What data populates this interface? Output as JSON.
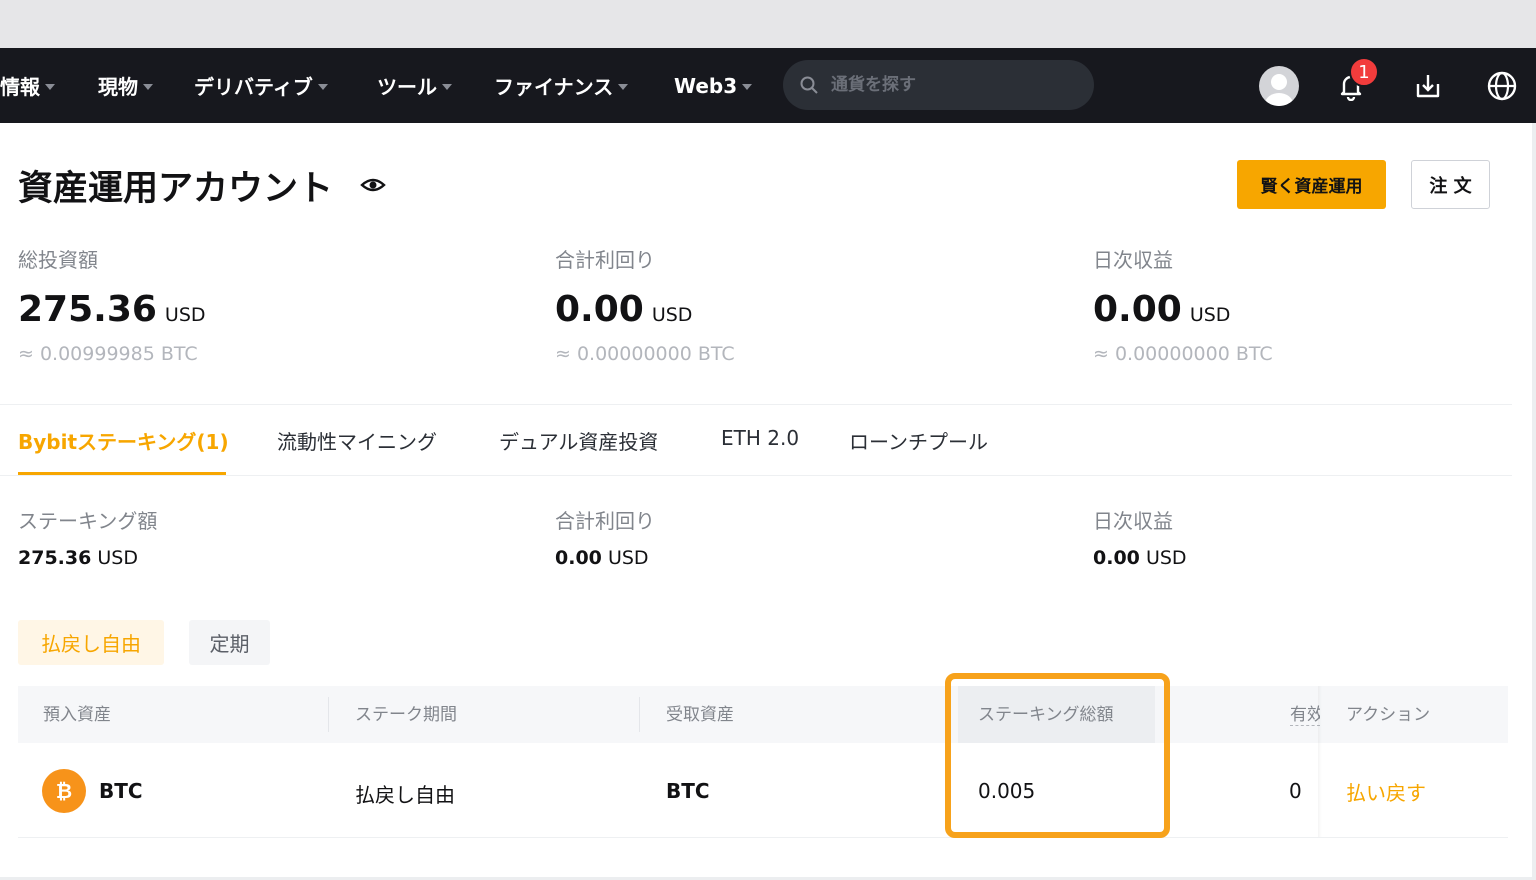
{
  "nav": {
    "items": [
      {
        "label": "情報"
      },
      {
        "label": "現物"
      },
      {
        "label": "デリバティブ"
      },
      {
        "label": "ツール"
      },
      {
        "label": "ファイナンス"
      },
      {
        "label": "Web3"
      }
    ],
    "search_placeholder": "通貨を探す",
    "notification_count": "1"
  },
  "page": {
    "title": "資産運用アカウント",
    "primary_button": "賢く資産運用",
    "secondary_button": "注 文"
  },
  "stats": [
    {
      "label": "総投資額",
      "value": "275.36",
      "unit": "USD",
      "sub": "≈ 0.00999985  BTC"
    },
    {
      "label": "合計利回り",
      "value": "0.00",
      "unit": "USD",
      "sub": "≈ 0.00000000  BTC"
    },
    {
      "label": "日次収益",
      "value": "0.00",
      "unit": "USD",
      "sub": "≈ 0.00000000  BTC"
    }
  ],
  "tabs": [
    {
      "label": "Bybitステーキング(1)",
      "active": true
    },
    {
      "label": "流動性マイニング"
    },
    {
      "label": "デュアル資産投資"
    },
    {
      "label": "ETH 2.0"
    },
    {
      "label": "ローンチプール"
    }
  ],
  "summary": [
    {
      "label": "ステーキング額",
      "value": "275.36",
      "unit": "USD"
    },
    {
      "label": "合計利回り",
      "value": "0.00",
      "unit": "USD"
    },
    {
      "label": "日次収益",
      "value": "0.00",
      "unit": "USD"
    }
  ],
  "filters": {
    "active": "払戻し自由",
    "inactive": "定期"
  },
  "table": {
    "headers": [
      "預入資産",
      "ステーク期間",
      "受取資産",
      "ステーキング総額",
      "有效",
      "アクション"
    ],
    "rows": [
      {
        "asset": "BTC",
        "coin_symbol": "₿",
        "period": "払戻し自由",
        "receive": "BTC",
        "total": "0.005",
        "valid": "0",
        "action": "払い戻す"
      }
    ]
  },
  "colors": {
    "accent": "#f7a600",
    "navbar": "#17181e",
    "highlight": "#f7a21b",
    "badge": "#f23c3c"
  }
}
